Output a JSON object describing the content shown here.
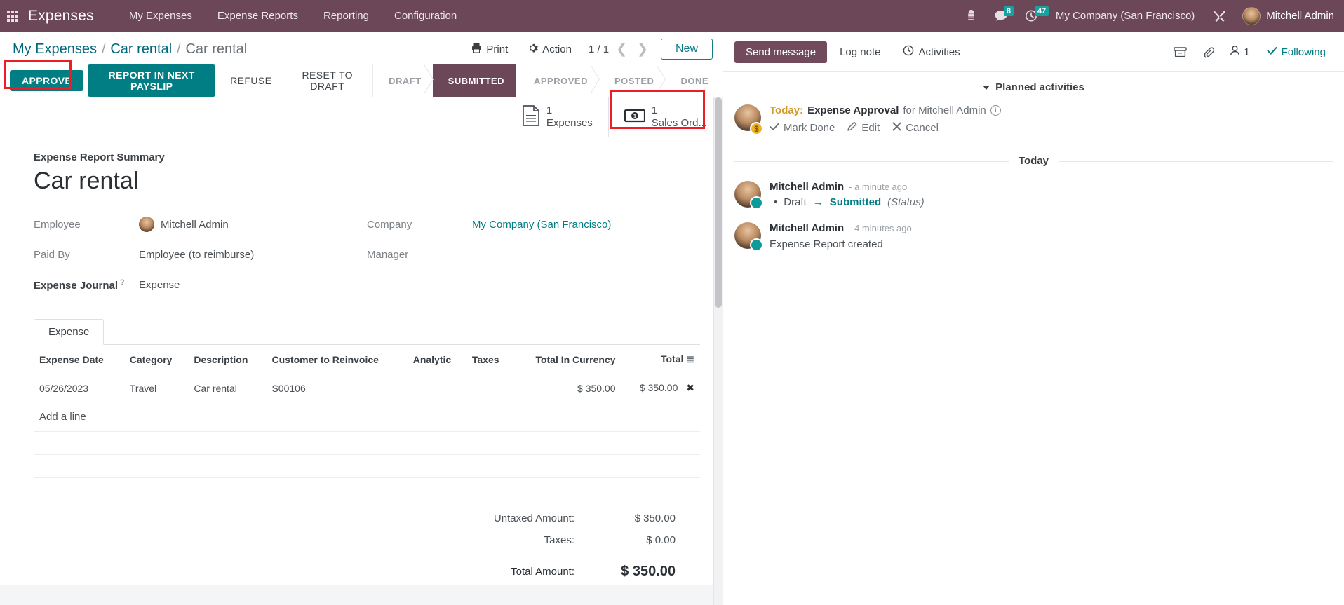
{
  "navbar": {
    "apps_icon": "apps-grid-icon",
    "brand": "Expenses",
    "menu": [
      {
        "label": "My Expenses"
      },
      {
        "label": "Expense Reports"
      },
      {
        "label": "Reporting"
      },
      {
        "label": "Configuration"
      }
    ],
    "icons": {
      "activities_icon": "megaphone-icon",
      "messages_icon": "chat-bubble-icon",
      "messages_count": "8",
      "clock_icon": "clock-icon",
      "clock_count": "47",
      "debug_icon": "wrench-screwdriver-icon"
    },
    "company": "My Company (San Francisco)",
    "user": "Mitchell Admin"
  },
  "control_panel": {
    "breadcrumb": [
      {
        "label": "My Expenses",
        "active": false
      },
      {
        "label": "Car rental",
        "active": false
      },
      {
        "label": "Car rental",
        "active": true
      }
    ],
    "separator": "/",
    "print_label": "Print",
    "print_icon": "printer-icon",
    "action_label": "Action",
    "action_icon": "gear-icon",
    "pager": "1 / 1",
    "prev_icon": "chevron-left-icon",
    "next_icon": "chevron-right-icon",
    "new_label": "New"
  },
  "statusbar": {
    "buttons": [
      {
        "label": "APPROVE",
        "style": "primary"
      },
      {
        "label": "REPORT IN NEXT PAYSLIP",
        "style": "primary"
      },
      {
        "label": "REFUSE",
        "style": "secondary"
      },
      {
        "label": "RESET TO DRAFT",
        "style": "secondary"
      }
    ],
    "stages": [
      {
        "label": "DRAFT",
        "active": false
      },
      {
        "label": "SUBMITTED",
        "active": true
      },
      {
        "label": "APPROVED",
        "active": false
      },
      {
        "label": "POSTED",
        "active": false
      },
      {
        "label": "DONE",
        "active": false
      }
    ]
  },
  "smart_buttons": [
    {
      "icon": "document-icon",
      "count": "1",
      "label": "Expenses"
    },
    {
      "icon": "money-bill-icon",
      "count": "1",
      "label": "Sales Ord..."
    }
  ],
  "form": {
    "summary_label": "Expense Report Summary",
    "title": "Car rental",
    "fields_left": [
      {
        "label": "Employee",
        "value": "Mitchell Admin",
        "avatar": true,
        "bold": false
      },
      {
        "label": "Paid By",
        "value": "Employee (to reimburse)",
        "avatar": false,
        "bold": false
      },
      {
        "label": "Expense Journal",
        "value": "Expense",
        "avatar": false,
        "bold": true,
        "help": "?"
      }
    ],
    "fields_right": [
      {
        "label": "Company",
        "value": "My Company (San Francisco)",
        "link": true
      },
      {
        "label": "Manager",
        "value": "",
        "link": false
      }
    ]
  },
  "notebook": {
    "tabs": [
      {
        "label": "Expense",
        "active": true
      }
    ],
    "columns": [
      "Expense Date",
      "Category",
      "Description",
      "Customer to Reinvoice",
      "Analytic",
      "Taxes",
      "Total In Currency",
      "Total"
    ],
    "rows": [
      {
        "expense_date": "05/26/2023",
        "category": "Travel",
        "description": "Car rental",
        "customer_to_reinvoice": "S00106",
        "analytic": "",
        "taxes": "",
        "total_in_currency": "$ 350.00",
        "total": "$ 350.00",
        "delete_icon": "close-x-icon"
      }
    ],
    "add_line_label": "Add a line",
    "options_icon": "column-options-icon"
  },
  "totals": [
    {
      "label": "Untaxed Amount:",
      "value": "$ 350.00",
      "grand": false
    },
    {
      "label": "Taxes:",
      "value": "$ 0.00",
      "grand": false
    },
    {
      "label": "Total Amount:",
      "value": "$ 350.00",
      "grand": true
    }
  ],
  "chatter": {
    "send_message_label": "Send message",
    "log_note_label": "Log note",
    "activities_label": "Activities",
    "activities_icon": "clock-plus-icon",
    "attachment_icon": "paperclip-icon",
    "archive_icon": "archive-icon",
    "followers_icon": "user-icon",
    "followers_count": "1",
    "following_label": "Following",
    "following_icon": "check-icon",
    "planned_activities_label": "Planned activities",
    "activity": {
      "today_label": "Today:",
      "type": "Expense Approval",
      "for_text": "for Mitchell Admin",
      "info_icon": "info-icon",
      "mark_done_label": "Mark Done",
      "mark_done_icon": "check-icon",
      "edit_label": "Edit",
      "edit_icon": "pencil-icon",
      "cancel_label": "Cancel",
      "cancel_icon": "close-x-icon",
      "avatar_badge": "$"
    },
    "today_divider": "Today",
    "messages": [
      {
        "author": "Mitchell Admin",
        "time": "- a minute ago",
        "bullet": "•",
        "track_old": "Draft",
        "track_arrow": "→",
        "track_new": "Submitted",
        "track_field": "(Status)",
        "body": ""
      },
      {
        "author": "Mitchell Admin",
        "time": "- 4 minutes ago",
        "body": "Expense Report created"
      }
    ]
  },
  "colors": {
    "navbar_bg": "#6b4758",
    "primary": "#017e84",
    "link": "#017e84",
    "badge": "#17a2a2",
    "annotation": "#ee1c25",
    "stage_active_bg": "#6b4758"
  }
}
